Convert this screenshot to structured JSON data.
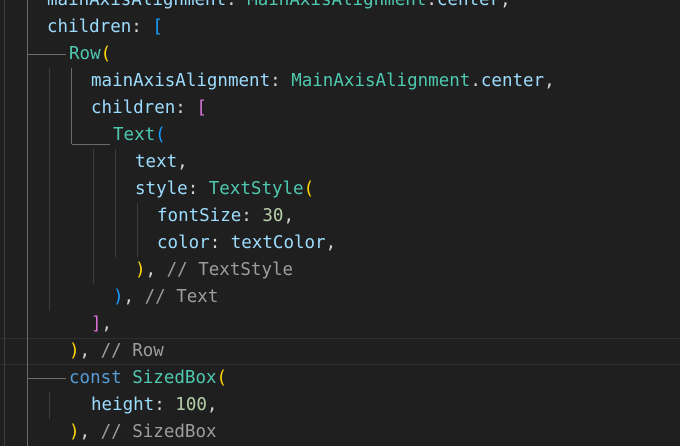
{
  "theme": {
    "background": "#1f1f1f",
    "property_color": "#9cdcfe",
    "class_color": "#4ec9b0",
    "keyword_color": "#569cd6",
    "number_color": "#b5cea8",
    "comment_color": "#9d9d9d",
    "bracket_colors": [
      "#ffd700",
      "#da70d6",
      "#179fff"
    ]
  },
  "editor": {
    "lines": [
      {
        "tokens": [
          {
            "text": "mainAxisAlignment",
            "cls": "tok-prop"
          },
          {
            "text": ": ",
            "cls": "tok-punc"
          },
          {
            "text": "MainAxisAlignment",
            "cls": "tok-class"
          },
          {
            "text": ".",
            "cls": "tok-punc"
          },
          {
            "text": "center",
            "cls": "tok-prop"
          },
          {
            "text": ",",
            "cls": "tok-punc"
          }
        ]
      },
      {
        "tokens": [
          {
            "text": "children",
            "cls": "tok-prop"
          },
          {
            "text": ": ",
            "cls": "tok-punc"
          },
          {
            "text": "[",
            "cls": "b-blue"
          }
        ]
      },
      {
        "tokens": [
          {
            "text": "Row",
            "cls": "tok-class"
          },
          {
            "text": "(",
            "cls": "b-yellow"
          }
        ]
      },
      {
        "tokens": [
          {
            "text": "mainAxisAlignment",
            "cls": "tok-prop"
          },
          {
            "text": ": ",
            "cls": "tok-punc"
          },
          {
            "text": "MainAxisAlignment",
            "cls": "tok-class"
          },
          {
            "text": ".",
            "cls": "tok-punc"
          },
          {
            "text": "center",
            "cls": "tok-prop"
          },
          {
            "text": ",",
            "cls": "tok-punc"
          }
        ]
      },
      {
        "tokens": [
          {
            "text": "children",
            "cls": "tok-prop"
          },
          {
            "text": ": ",
            "cls": "tok-punc"
          },
          {
            "text": "[",
            "cls": "b-magenta"
          }
        ]
      },
      {
        "tokens": [
          {
            "text": "Text",
            "cls": "tok-class"
          },
          {
            "text": "(",
            "cls": "b-blue"
          }
        ]
      },
      {
        "tokens": [
          {
            "text": "text",
            "cls": "tok-prop"
          },
          {
            "text": ",",
            "cls": "tok-punc"
          }
        ]
      },
      {
        "tokens": [
          {
            "text": "style",
            "cls": "tok-prop"
          },
          {
            "text": ": ",
            "cls": "tok-punc"
          },
          {
            "text": "TextStyle",
            "cls": "tok-class"
          },
          {
            "text": "(",
            "cls": "b-yellow"
          }
        ]
      },
      {
        "tokens": [
          {
            "text": "fontSize",
            "cls": "tok-prop"
          },
          {
            "text": ": ",
            "cls": "tok-punc"
          },
          {
            "text": "30",
            "cls": "tok-num"
          },
          {
            "text": ",",
            "cls": "tok-punc"
          }
        ]
      },
      {
        "tokens": [
          {
            "text": "color",
            "cls": "tok-prop"
          },
          {
            "text": ": ",
            "cls": "tok-punc"
          },
          {
            "text": "textColor",
            "cls": "tok-prop"
          },
          {
            "text": ",",
            "cls": "tok-punc"
          }
        ]
      },
      {
        "tokens": [
          {
            "text": ")",
            "cls": "b-yellow"
          },
          {
            "text": ", ",
            "cls": "tok-punc"
          },
          {
            "text": "// TextStyle",
            "cls": "tok-comment"
          }
        ]
      },
      {
        "tokens": [
          {
            "text": ")",
            "cls": "b-blue"
          },
          {
            "text": ", ",
            "cls": "tok-punc"
          },
          {
            "text": "// Text",
            "cls": "tok-comment"
          }
        ]
      },
      {
        "tokens": [
          {
            "text": "]",
            "cls": "b-magenta"
          },
          {
            "text": ",",
            "cls": "tok-punc"
          }
        ]
      },
      {
        "tokens": [
          {
            "text": ")",
            "cls": "b-yellow"
          },
          {
            "text": ", ",
            "cls": "tok-punc"
          },
          {
            "text": "// Row",
            "cls": "tok-comment"
          }
        ]
      },
      {
        "tokens": [
          {
            "text": "const",
            "cls": "tok-kw"
          },
          {
            "text": " ",
            "cls": "tok-punc"
          },
          {
            "text": "SizedBox",
            "cls": "tok-class"
          },
          {
            "text": "(",
            "cls": "b-yellow"
          }
        ]
      },
      {
        "tokens": [
          {
            "text": "height",
            "cls": "tok-prop"
          },
          {
            "text": ": ",
            "cls": "tok-punc"
          },
          {
            "text": "100",
            "cls": "tok-num"
          },
          {
            "text": ",",
            "cls": "tok-punc"
          }
        ]
      },
      {
        "tokens": [
          {
            "text": ")",
            "cls": "b-yellow"
          },
          {
            "text": ", ",
            "cls": "tok-punc"
          },
          {
            "text": "// SizedBox",
            "cls": "tok-comment"
          }
        ]
      }
    ]
  }
}
